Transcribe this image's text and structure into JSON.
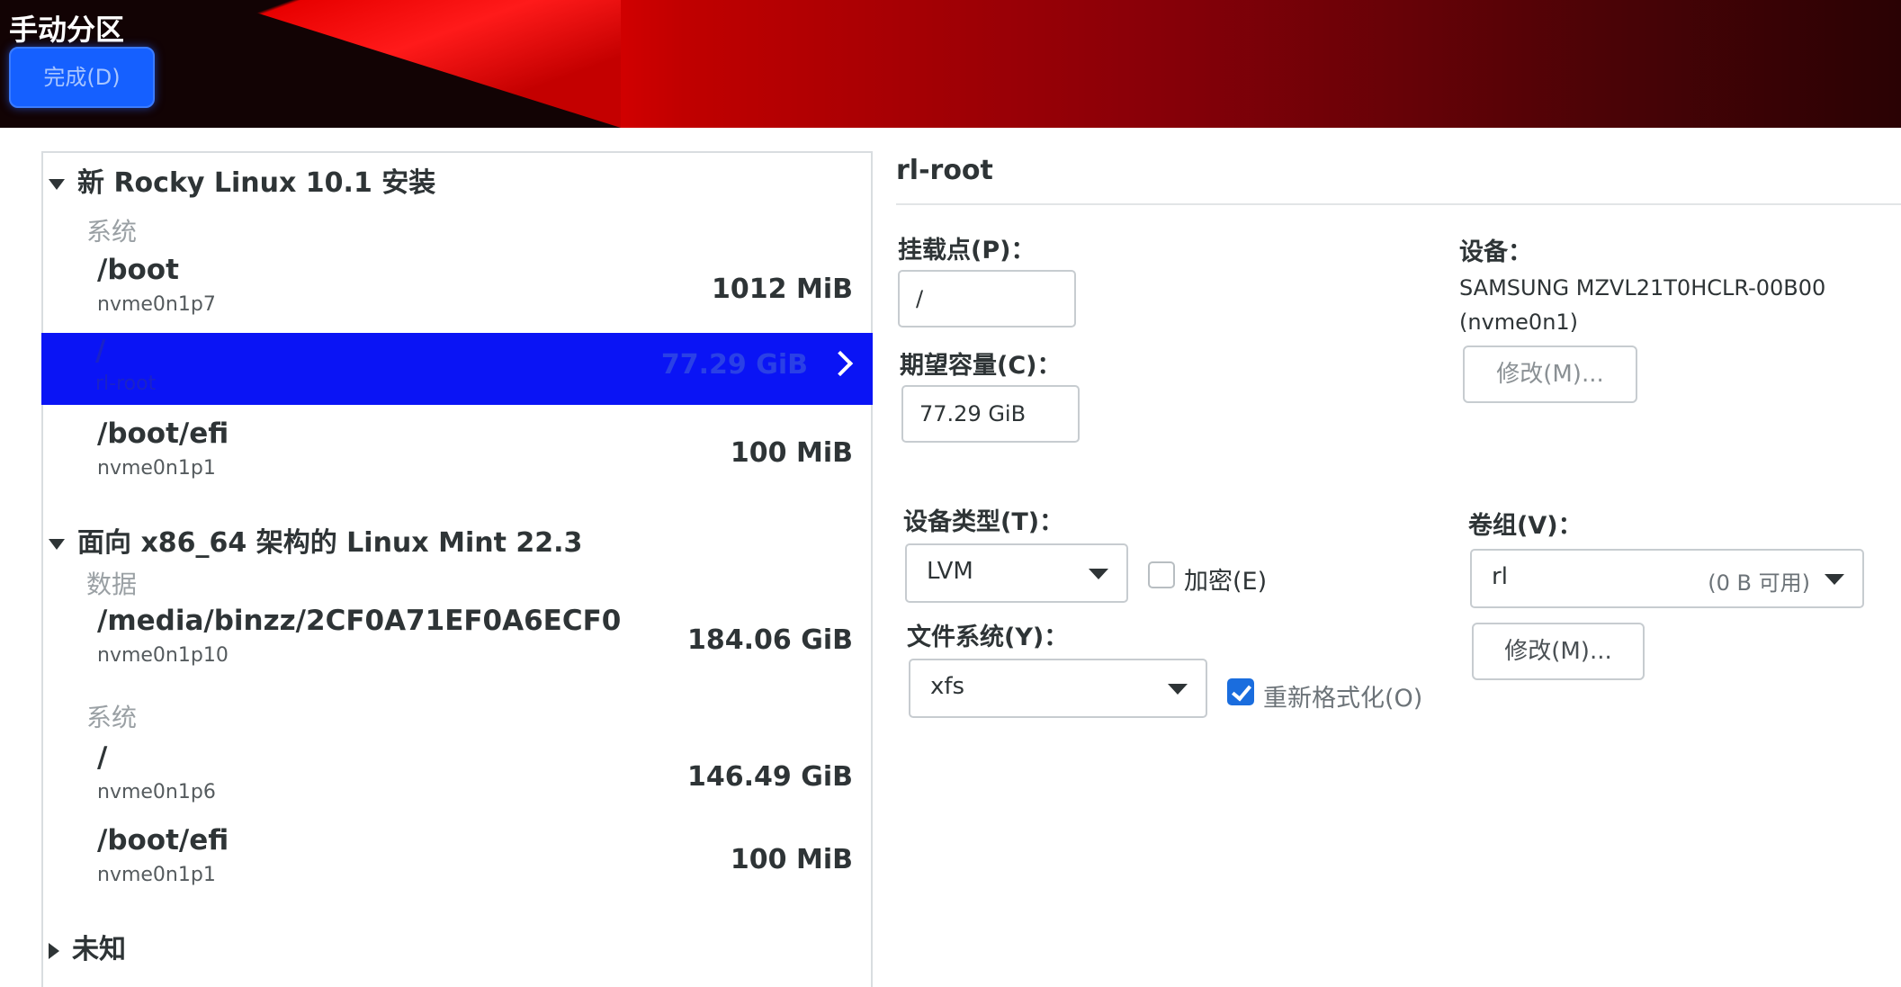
{
  "header": {
    "title": "手动分区",
    "done_button": "完成(D)"
  },
  "tree": {
    "groups": [
      {
        "name": "新 Rocky Linux 10.1 安装",
        "sections": [
          {
            "label": "系统",
            "items": [
              {
                "mount": "/boot",
                "device": "nvme0n1p7",
                "size": "1012 MiB"
              },
              {
                "mount": "/",
                "device": "rl-root",
                "size": "77.29 GiB",
                "selected": true
              },
              {
                "mount": "/boot/efi",
                "device": "nvme0n1p1",
                "size": "100 MiB"
              }
            ]
          }
        ]
      },
      {
        "name": "面向 x86_64 架构的 Linux Mint 22.3",
        "sections": [
          {
            "label": "数据",
            "items": [
              {
                "mount": "/media/binzz/2CF0A71EF0A6ECF0",
                "device": "nvme0n1p10",
                "size": "184.06 GiB"
              }
            ]
          },
          {
            "label": "系统",
            "items": [
              {
                "mount": "/",
                "device": "nvme0n1p6",
                "size": "146.49 GiB"
              },
              {
                "mount": "/boot/efi",
                "device": "nvme0n1p1",
                "size": "100 MiB"
              }
            ]
          }
        ]
      },
      {
        "name": "未知",
        "sections": []
      }
    ]
  },
  "details": {
    "title": "rl-root",
    "mount_point_label": "挂载点(P)：",
    "mount_point_value": "/",
    "desired_capacity_label": "期望容量(C)：",
    "desired_capacity_value": "77.29 GiB",
    "device_label": "设备：",
    "device_name": "SAMSUNG MZVL21T0HCLR-00B00",
    "device_id": "(nvme0n1)",
    "modify_device_button": "修改(M)...",
    "device_type_label": "设备类型(T)：",
    "device_type_value": "LVM",
    "encrypt_label": "加密(E)",
    "encrypt_checked": false,
    "filesystem_label": "文件系统(Y)：",
    "filesystem_value": "xfs",
    "reformat_label": "重新格式化(O)",
    "reformat_checked": true,
    "volume_group_label": "卷组(V)：",
    "volume_group_value": "rl",
    "volume_group_free": "(0 B 可用)",
    "modify_volume_group_button": "修改(M)..."
  },
  "colors": {
    "selection": "#0a14f5",
    "accent_button": "#1560ff",
    "checkbox_checked": "#1a6dde"
  }
}
